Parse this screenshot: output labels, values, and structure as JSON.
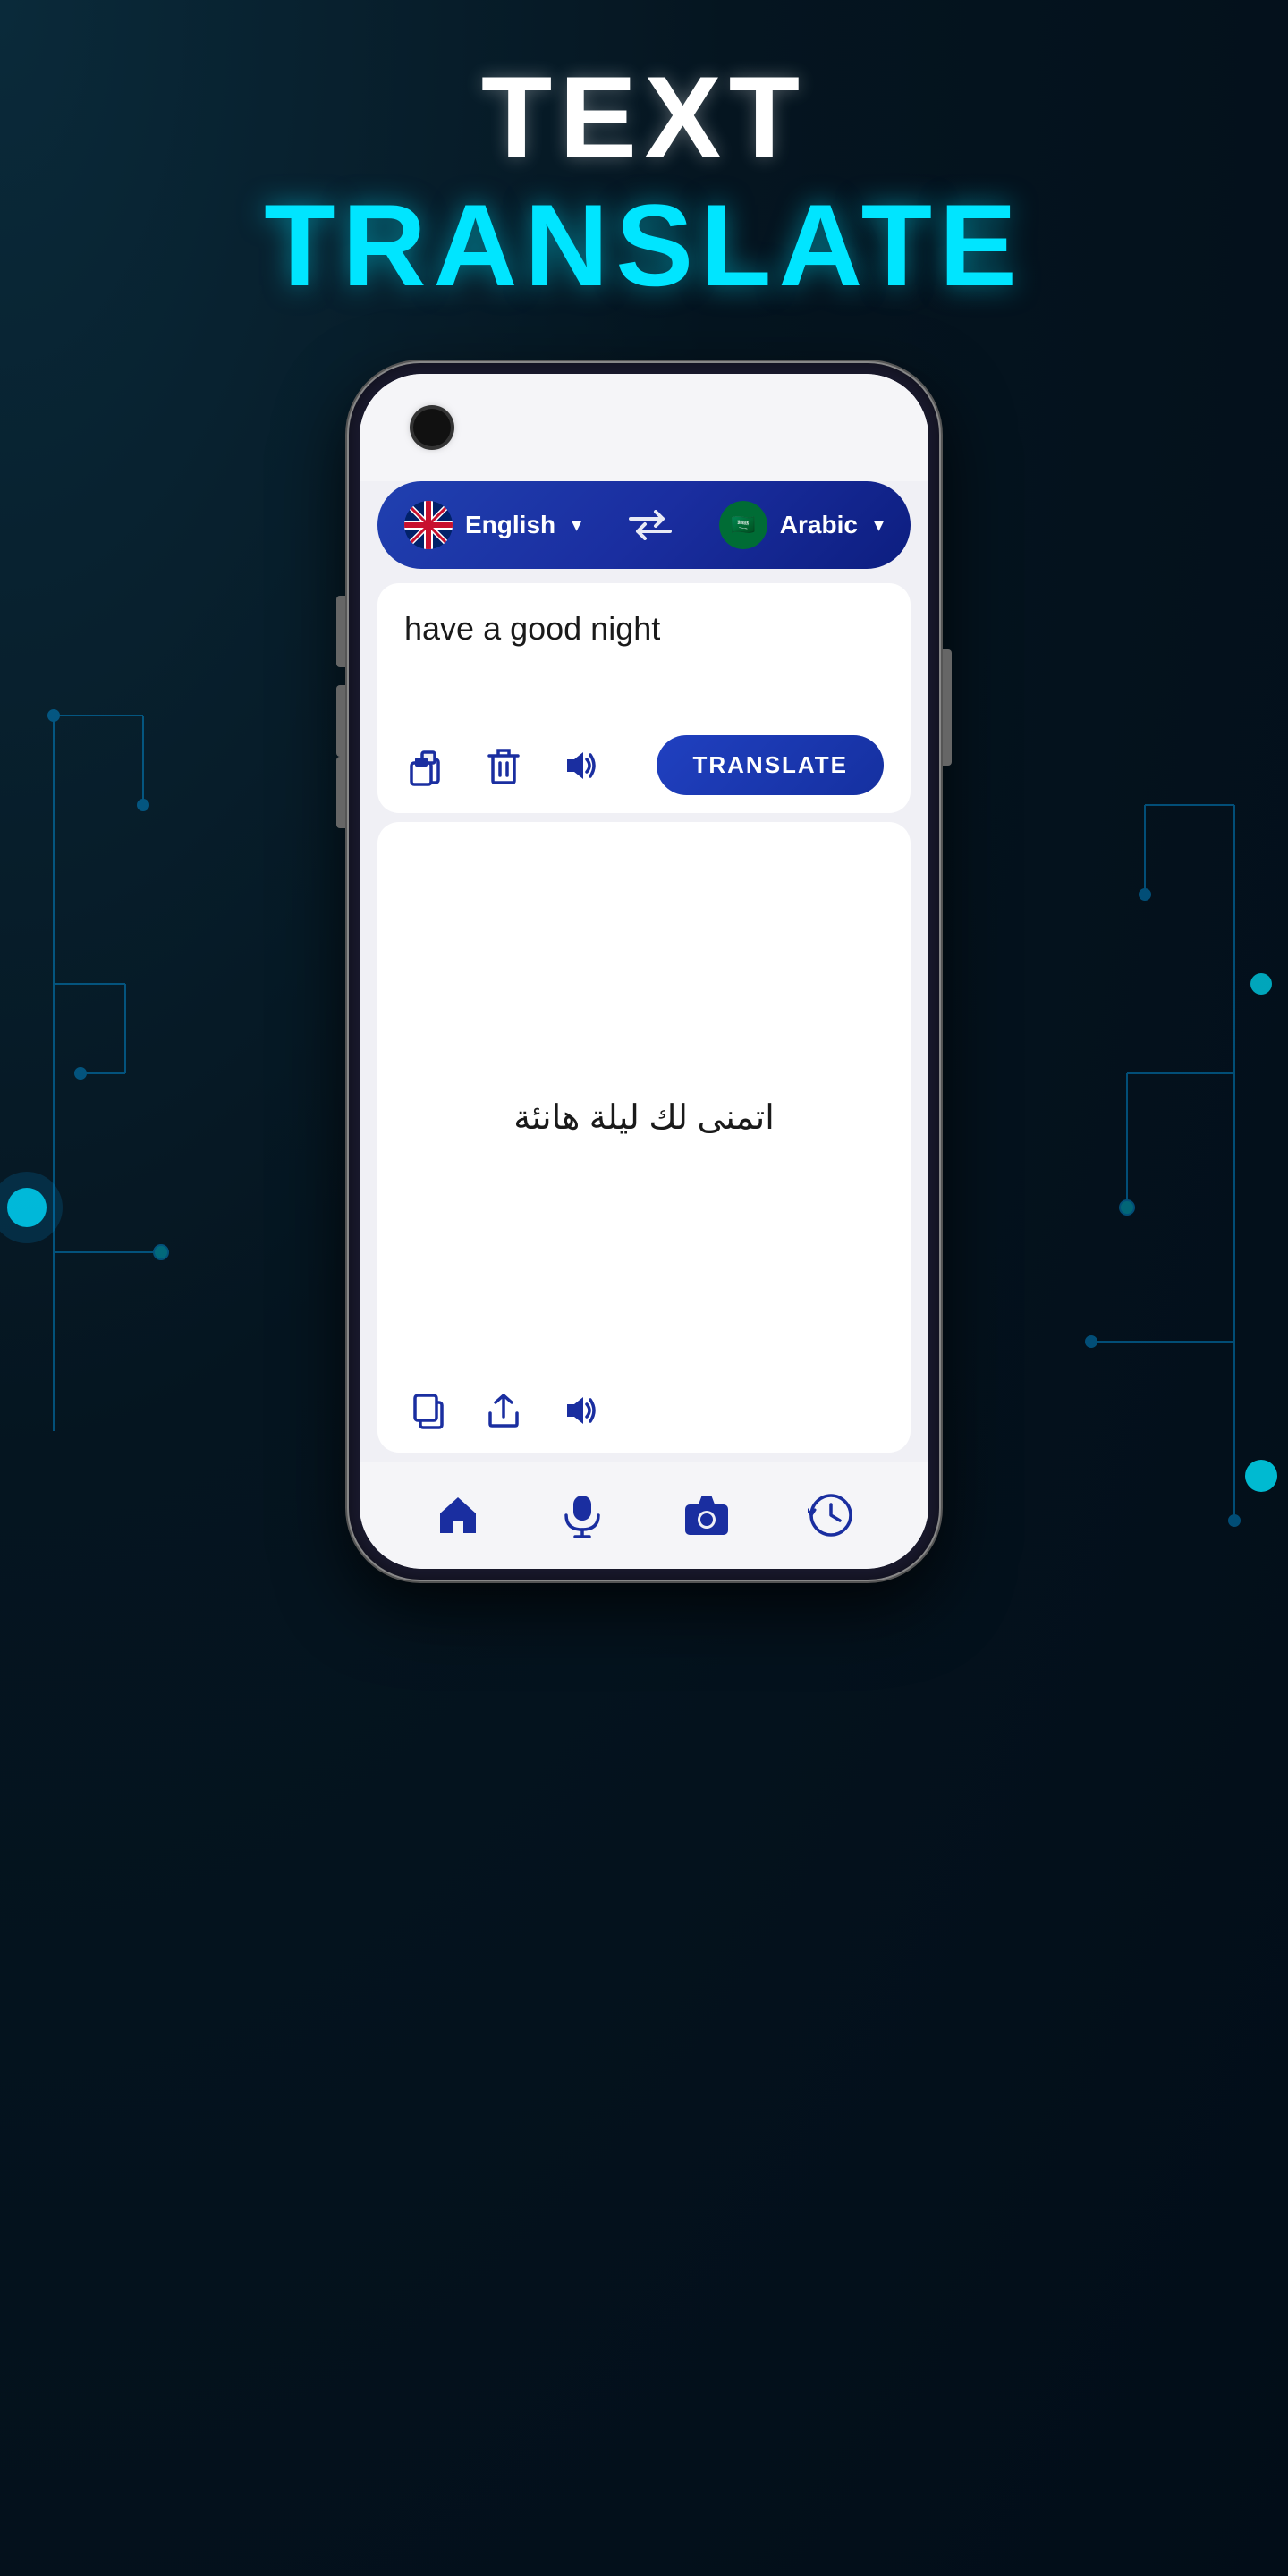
{
  "page": {
    "title_line1": "TEXT",
    "title_line2": "TRANSLATE"
  },
  "lang_bar": {
    "source_lang": "English",
    "target_lang": "Arabic",
    "swap_label": "swap languages"
  },
  "input": {
    "text": "have a good night",
    "translate_button": "TRANSLATE"
  },
  "output": {
    "text": "اتمنى لك ليلة هانئة"
  },
  "actions_input": {
    "paste_label": "paste",
    "delete_label": "delete",
    "speak_label": "speak"
  },
  "actions_output": {
    "copy_label": "copy",
    "share_label": "share",
    "speak_label": "speak"
  },
  "nav": {
    "home_label": "home",
    "mic_label": "microphone",
    "camera_label": "camera",
    "history_label": "history"
  },
  "colors": {
    "accent_cyan": "#00e5ff",
    "nav_blue": "#1a2ea0",
    "bg_dark": "#051520"
  }
}
